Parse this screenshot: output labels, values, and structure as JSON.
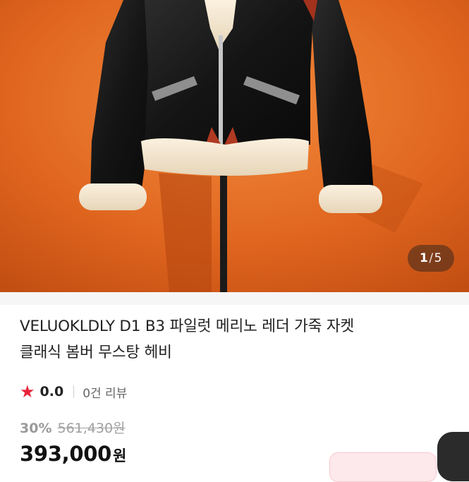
{
  "gallery": {
    "current": "1",
    "separator": "/",
    "total": "5",
    "image_subject": "jacket-photo"
  },
  "product": {
    "title_line1": "VELUOKLDLY D1 B3 파일럿 메리노 레더 가죽 자켓",
    "title_line2": "클래식 봄버 무스탕 헤비"
  },
  "rating": {
    "star_icon": "star-icon",
    "score": "0.0",
    "review_count": "0건 리뷰"
  },
  "pricing": {
    "discount": "30%",
    "original_price": "561,430원",
    "price": "393,000",
    "currency": "원"
  },
  "colors": {
    "accent": "#e8233a",
    "background_orange": "#e0661f"
  }
}
